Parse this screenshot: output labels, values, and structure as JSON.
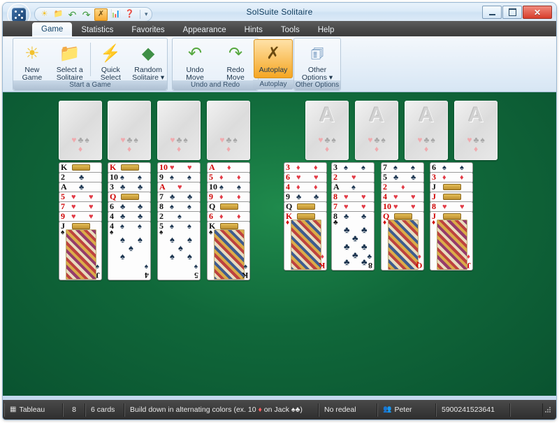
{
  "window": {
    "title": "SolSuite Solitaire",
    "buttons": {
      "minimize": "minimize-button",
      "maximize": "maximize-button",
      "close": "close-button"
    }
  },
  "quick_access": {
    "items": [
      {
        "name": "new-game",
        "glyph": "☀",
        "active": false
      },
      {
        "name": "select-solitaire",
        "glyph": "📁",
        "active": false
      },
      {
        "name": "undo-move",
        "glyph": "↶",
        "active": false
      },
      {
        "name": "redo-move",
        "glyph": "↷",
        "active": false
      },
      {
        "name": "autoplay",
        "glyph": "✗",
        "active": true
      },
      {
        "name": "statistics",
        "glyph": "📊",
        "active": false
      },
      {
        "name": "help",
        "glyph": "?",
        "active": false
      }
    ],
    "overflow": "▾"
  },
  "tabs": [
    {
      "label": "Game",
      "active": true
    },
    {
      "label": "Statistics",
      "active": false
    },
    {
      "label": "Favorites",
      "active": false
    },
    {
      "label": "Appearance",
      "active": false
    },
    {
      "label": "Hints",
      "active": false
    },
    {
      "label": "Tools",
      "active": false
    },
    {
      "label": "Help",
      "active": false
    }
  ],
  "ribbon": {
    "groups": [
      {
        "caption": "Start a Game",
        "buttons": [
          {
            "line1": "New",
            "line2": "Game",
            "icon": "☀",
            "highlight": false
          },
          {
            "line1": "Select a",
            "line2": "Solitaire",
            "icon": "📁",
            "highlight": false
          },
          {
            "line1": "Quick",
            "line2": "Select",
            "icon": "⚡",
            "highlight": false
          },
          {
            "line1": "Random",
            "line2": "Solitaire ▾",
            "icon": "◆",
            "highlight": false
          }
        ]
      },
      {
        "caption": "Undo and Redo",
        "buttons": [
          {
            "line1": "Undo",
            "line2": "Move",
            "icon": "↶",
            "highlight": false
          },
          {
            "line1": "Redo",
            "line2": "Move",
            "icon": "↷",
            "highlight": false
          }
        ]
      },
      {
        "caption": "Autoplay",
        "buttons": [
          {
            "line1": "Autoplay",
            "line2": "",
            "icon": "✗",
            "highlight": true
          }
        ]
      },
      {
        "caption": "Other Options",
        "buttons": [
          {
            "line1": "Other",
            "line2": "Options ▾",
            "icon": "🗒",
            "highlight": false
          }
        ]
      }
    ]
  },
  "board": {
    "free_cells": [
      {
        "label": "",
        "suits": [
          "♥",
          "♣",
          "♠",
          "♦"
        ]
      },
      {
        "label": "",
        "suits": [
          "♥",
          "♣",
          "♠",
          "♦"
        ]
      },
      {
        "label": "",
        "suits": [
          "♥",
          "♣",
          "♠",
          "♦"
        ]
      },
      {
        "label": "",
        "suits": [
          "♥",
          "♣",
          "♠",
          "♦"
        ]
      }
    ],
    "foundations": [
      {
        "label": "A",
        "suits": [
          "♥",
          "♣",
          "♠",
          "♦"
        ]
      },
      {
        "label": "A",
        "suits": [
          "♥",
          "♣",
          "♠",
          "♦"
        ]
      },
      {
        "label": "A",
        "suits": [
          "♥",
          "♣",
          "♠",
          "♦"
        ]
      },
      {
        "label": "A",
        "suits": [
          "♥",
          "♣",
          "♠",
          "♦"
        ]
      }
    ],
    "tableau": [
      {
        "cards": [
          {
            "rank": "K",
            "suit": "♠",
            "color": "blk",
            "court": true
          },
          {
            "rank": "2",
            "suit": "♣",
            "color": "blk",
            "court": false
          },
          {
            "rank": "A",
            "suit": "♣",
            "color": "blk",
            "court": false
          },
          {
            "rank": "5",
            "suit": "♥",
            "color": "red",
            "court": false
          },
          {
            "rank": "7",
            "suit": "♥",
            "color": "red",
            "court": false
          },
          {
            "rank": "9",
            "suit": "♥",
            "color": "red",
            "court": false
          },
          {
            "rank": "J",
            "suit": "♠",
            "color": "blk",
            "court": true
          }
        ]
      },
      {
        "cards": [
          {
            "rank": "K",
            "suit": "♥",
            "color": "red",
            "court": true
          },
          {
            "rank": "10",
            "suit": "♠",
            "color": "blk",
            "court": false
          },
          {
            "rank": "3",
            "suit": "♣",
            "color": "blk",
            "court": false
          },
          {
            "rank": "Q",
            "suit": "♦",
            "color": "red",
            "court": true
          },
          {
            "rank": "6",
            "suit": "♣",
            "color": "blk",
            "court": false
          },
          {
            "rank": "4",
            "suit": "♣",
            "color": "blk",
            "court": false
          },
          {
            "rank": "4",
            "suit": "♠",
            "color": "blk",
            "court": false
          }
        ]
      },
      {
        "cards": [
          {
            "rank": "10",
            "suit": "♥",
            "color": "red",
            "court": false
          },
          {
            "rank": "9",
            "suit": "♠",
            "color": "blk",
            "court": false
          },
          {
            "rank": "A",
            "suit": "♥",
            "color": "red",
            "court": false
          },
          {
            "rank": "7",
            "suit": "♣",
            "color": "blk",
            "court": false
          },
          {
            "rank": "8",
            "suit": "♠",
            "color": "blk",
            "court": false
          },
          {
            "rank": "2",
            "suit": "♠",
            "color": "blk",
            "court": false
          },
          {
            "rank": "5",
            "suit": "♠",
            "color": "blk",
            "court": false
          }
        ]
      },
      {
        "cards": [
          {
            "rank": "A",
            "suit": "♦",
            "color": "red",
            "court": false
          },
          {
            "rank": "5",
            "suit": "♦",
            "color": "red",
            "court": false
          },
          {
            "rank": "10",
            "suit": "♠",
            "color": "blk",
            "court": false
          },
          {
            "rank": "9",
            "suit": "♦",
            "color": "red",
            "court": false
          },
          {
            "rank": "Q",
            "suit": "♣",
            "color": "blk",
            "court": true
          },
          {
            "rank": "6",
            "suit": "♦",
            "color": "red",
            "court": false
          },
          {
            "rank": "K",
            "suit": "♠",
            "color": "blk",
            "court": true
          }
        ]
      },
      {
        "cards": [
          {
            "rank": "3",
            "suit": "♦",
            "color": "red",
            "court": false
          },
          {
            "rank": "6",
            "suit": "♥",
            "color": "red",
            "court": false
          },
          {
            "rank": "4",
            "suit": "♦",
            "color": "red",
            "court": false
          },
          {
            "rank": "9",
            "suit": "♣",
            "color": "blk",
            "court": false
          },
          {
            "rank": "Q",
            "suit": "♠",
            "color": "blk",
            "court": true
          },
          {
            "rank": "K",
            "suit": "♦",
            "color": "red",
            "court": true
          }
        ]
      },
      {
        "cards": [
          {
            "rank": "3",
            "suit": "♠",
            "color": "blk",
            "court": false
          },
          {
            "rank": "2",
            "suit": "♥",
            "color": "red",
            "court": false
          },
          {
            "rank": "A",
            "suit": "♠",
            "color": "blk",
            "court": false
          },
          {
            "rank": "8",
            "suit": "♥",
            "color": "red",
            "court": false
          },
          {
            "rank": "7",
            "suit": "♥",
            "color": "red",
            "court": false
          },
          {
            "rank": "8",
            "suit": "♣",
            "color": "blk",
            "court": false
          }
        ]
      },
      {
        "cards": [
          {
            "rank": "7",
            "suit": "♠",
            "color": "blk",
            "court": false
          },
          {
            "rank": "5",
            "suit": "♣",
            "color": "blk",
            "court": false
          },
          {
            "rank": "2",
            "suit": "♦",
            "color": "red",
            "court": false
          },
          {
            "rank": "4",
            "suit": "♥",
            "color": "red",
            "court": false
          },
          {
            "rank": "10",
            "suit": "♥",
            "color": "red",
            "court": false
          },
          {
            "rank": "Q",
            "suit": "♦",
            "color": "red",
            "court": true
          }
        ]
      },
      {
        "cards": [
          {
            "rank": "6",
            "suit": "♠",
            "color": "blk",
            "court": false
          },
          {
            "rank": "3",
            "suit": "♦",
            "color": "red",
            "court": false
          },
          {
            "rank": "J",
            "suit": "♣",
            "color": "blk",
            "court": true
          },
          {
            "rank": "J",
            "suit": "♥",
            "color": "red",
            "court": true
          },
          {
            "rank": "8",
            "suit": "♥",
            "color": "red",
            "court": false
          },
          {
            "rank": "J",
            "suit": "♦",
            "color": "red",
            "court": true
          }
        ]
      }
    ]
  },
  "status_bar": {
    "pile_type": "Tableau",
    "pile_count": "8",
    "pile_size": "6 cards",
    "rule_text": "Build down in alternating colors (ex. 10 ♦ on Jack ♠♣)",
    "redeal": "No redeal",
    "player": "Peter",
    "game_number": "5900241523641"
  },
  "colors": {
    "felt": "#10683a",
    "accent": "#f5a623",
    "tab_bar": "#4a4a4a",
    "red_suit": "#d00000",
    "black_suit": "#111111"
  }
}
